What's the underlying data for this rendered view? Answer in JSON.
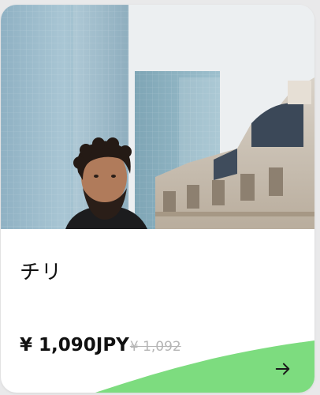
{
  "card": {
    "title": "チリ",
    "price": "¥ 1,090JPY",
    "old_price": "¥ 1,092",
    "accent_color": "#7ddc7f"
  },
  "icons": {
    "next": "arrow-right-icon"
  }
}
